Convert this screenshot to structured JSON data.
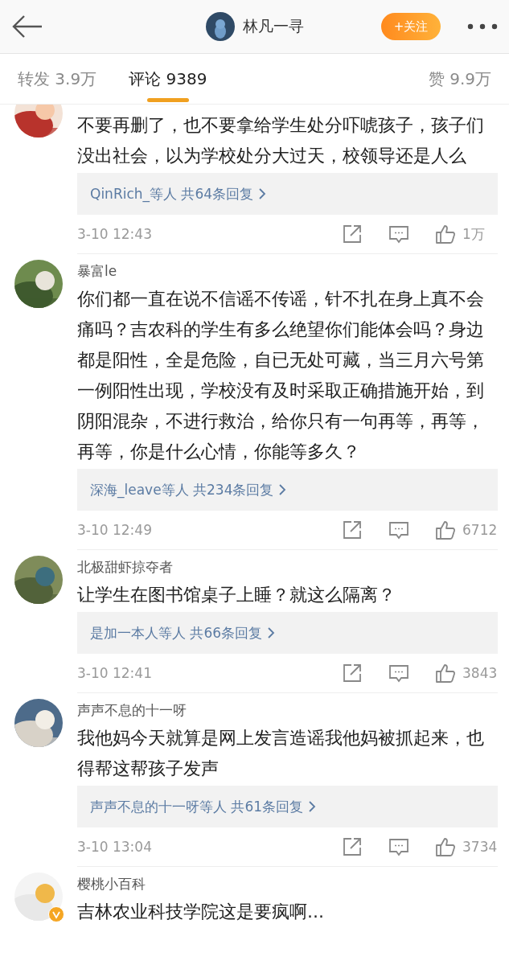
{
  "header": {
    "username": "林凡一寻",
    "follow_button": "+关注"
  },
  "tabs": [
    {
      "label": "转发 3.9万",
      "selected": false
    },
    {
      "label": "评论 9389",
      "selected": true
    },
    {
      "label": "赞 9.9万",
      "selected": false
    }
  ],
  "comments": [
    {
      "text": "不要再删了，也不要拿给学生处分吓唬孩子，孩子们没出社会，以为学校处分大过天，校领导还是人么",
      "replies": "QinRich_等人 共64条回复",
      "time": "3-10 12:43",
      "likes": "1万"
    },
    {
      "name": "暴富le",
      "text": "你们都一直在说不信谣不传谣，针不扎在身上真不会痛吗？吉农科的学生有多么绝望你们能体会吗？身边都是阳性，全是危险，自已无处可藏，当三月六号第一例阳性出现，学校没有及时采取正确措施开始，到阴阳混杂，不进行救治，给你只有一句再等，再等，再等，你是什么心情，你能等多久？",
      "replies": "深海_leave等人 共234条回复",
      "time": "3-10 12:49",
      "likes": "6712"
    },
    {
      "name": "北极甜虾掠夺者",
      "text": "让学生在图书馆桌子上睡？就这么隔离？",
      "replies": "是加一本人等人 共66条回复",
      "time": "3-10 12:41",
      "likes": "3843"
    },
    {
      "name": "声声不息的十一呀",
      "text": "我他妈今天就算是网上发言造谣我他妈被抓起来，也得帮这帮孩子发声",
      "replies": "声声不息的十一呀等人 共61条回复",
      "time": "3-10 13:04",
      "likes": "3734"
    },
    {
      "name": "樱桃小百科",
      "verified": true,
      "text": "吉林农业科技学院这是要疯啊..."
    }
  ]
}
